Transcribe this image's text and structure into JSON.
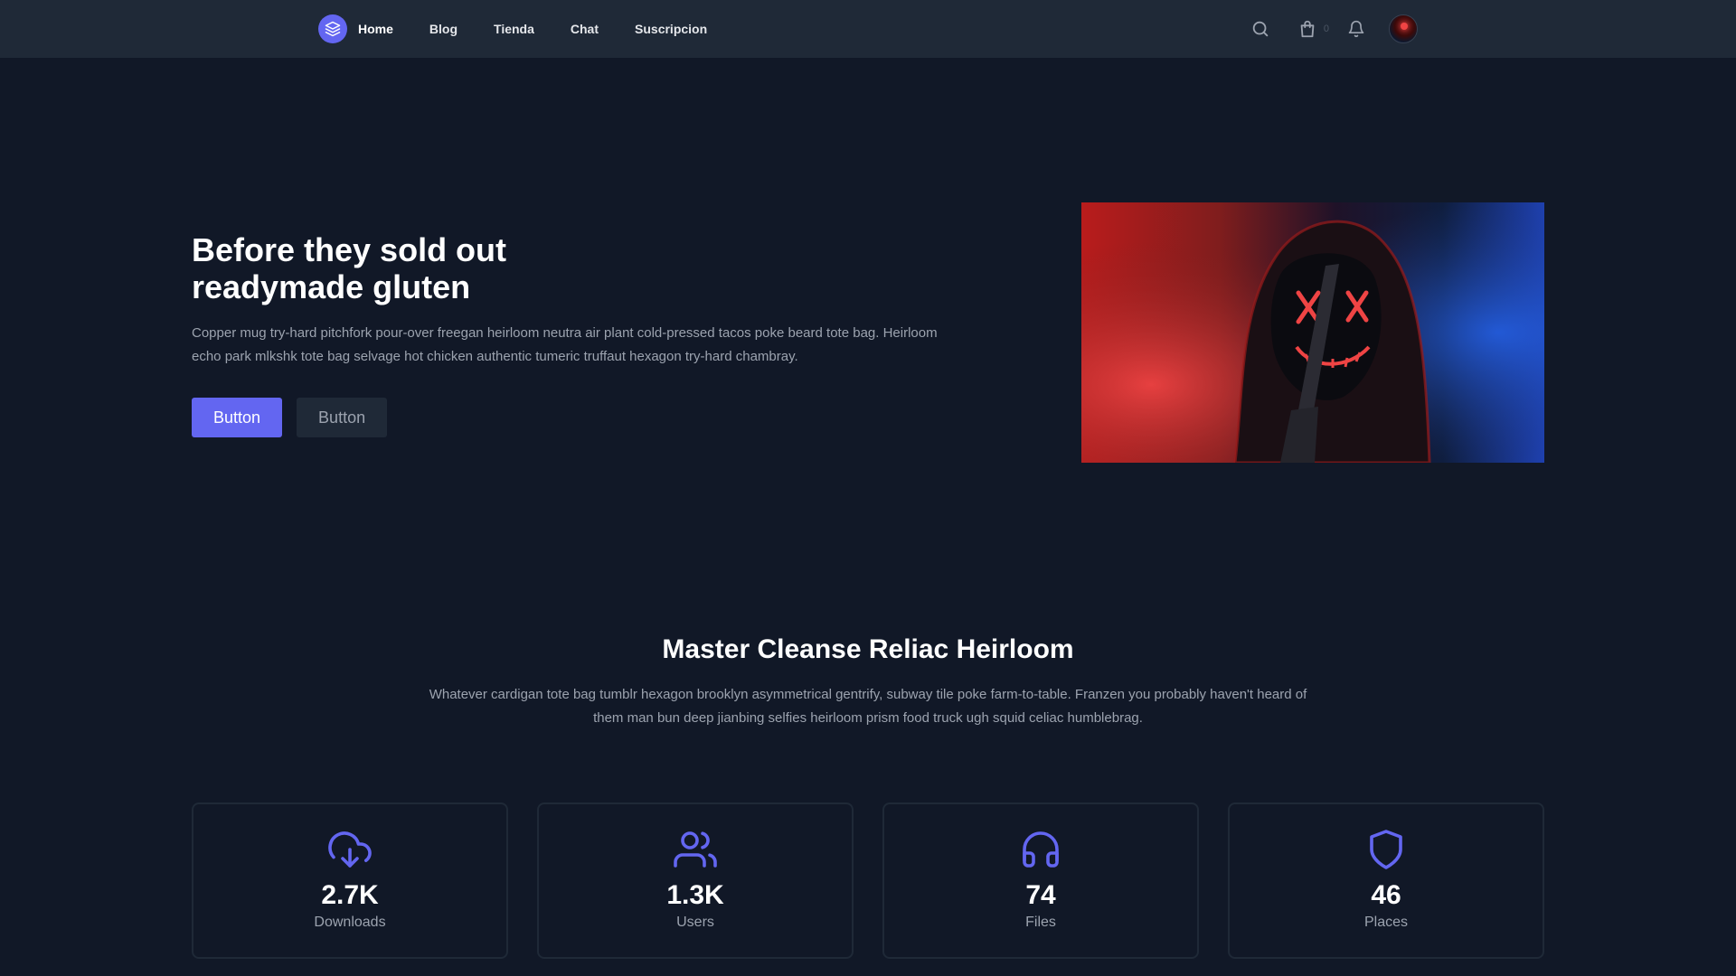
{
  "nav": {
    "links": [
      {
        "label": "Home",
        "active": true
      },
      {
        "label": "Blog",
        "active": false
      },
      {
        "label": "Tienda",
        "active": false
      },
      {
        "label": "Chat",
        "active": false
      },
      {
        "label": "Suscripcion",
        "active": false
      }
    ],
    "cart_count": "0",
    "icons": [
      "layers-logo-icon",
      "search-icon",
      "shopping-bag-icon",
      "bell-icon",
      "avatar"
    ]
  },
  "hero": {
    "title": "Before they sold out\nreadymade gluten",
    "description": "Copper mug try-hard pitchfork pour-over freegan heirloom neutra air plant cold-pressed tacos poke beard tote bag. Heirloom echo park mlkshk tote bag selvage hot chicken authentic tumeric truffaut hexagon try-hard chambray.",
    "primary_button": "Button",
    "secondary_button": "Button",
    "image": "hooded figure with neon X mask"
  },
  "stats_section": {
    "title": "Master Cleanse Reliac Heirloom",
    "description": "Whatever cardigan tote bag tumblr hexagon brooklyn asymmetrical gentrify, subway tile poke farm-to-table. Franzen you probably haven't heard of them man bun deep jianbing selfies heirloom prism food truck ugh squid celiac humblebrag.",
    "stats": [
      {
        "value": "2.7K",
        "label": "Downloads",
        "icon": "cloud-download-icon"
      },
      {
        "value": "1.3K",
        "label": "Users",
        "icon": "users-icon"
      },
      {
        "value": "74",
        "label": "Files",
        "icon": "headphones-icon"
      },
      {
        "value": "46",
        "label": "Places",
        "icon": "shield-icon"
      }
    ]
  },
  "colors": {
    "background": "#111827",
    "navbar": "#1f2937",
    "accent": "#6366f1",
    "text_muted": "#9ca3af"
  }
}
